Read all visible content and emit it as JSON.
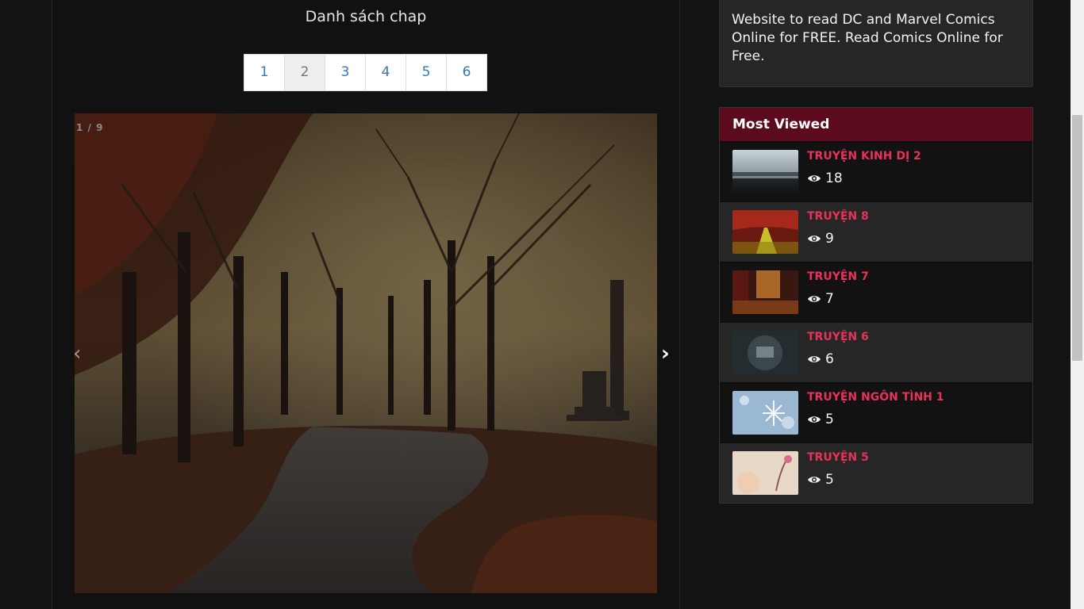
{
  "main": {
    "chap_title": "Danh sách chap",
    "pages": [
      "1",
      "2",
      "3",
      "4",
      "5",
      "6"
    ],
    "active_page": "2",
    "slider": {
      "counter": "1 / 9",
      "prev_label": "‹",
      "next_label": "›"
    }
  },
  "sidebar": {
    "about_text": "Website to read DC and Marvel Comics Online for FREE. Read Comics Online for Free.",
    "most_viewed": {
      "title": "Most Viewed",
      "items": [
        {
          "title": "TRUYỆN KINH DỊ 2",
          "views": "18"
        },
        {
          "title": "TRUYỆN 8",
          "views": "9"
        },
        {
          "title": "TRUYỆN 7",
          "views": "7"
        },
        {
          "title": "TRUYỆN 6",
          "views": "6"
        },
        {
          "title": "TRUYỆN NGÔN TÌNH 1",
          "views": "5"
        },
        {
          "title": "TRUYỆN 5",
          "views": "5"
        }
      ]
    }
  },
  "colors": {
    "accent": "#e8325a",
    "header_bg": "#5c0a1e",
    "link": "#337ab7"
  }
}
